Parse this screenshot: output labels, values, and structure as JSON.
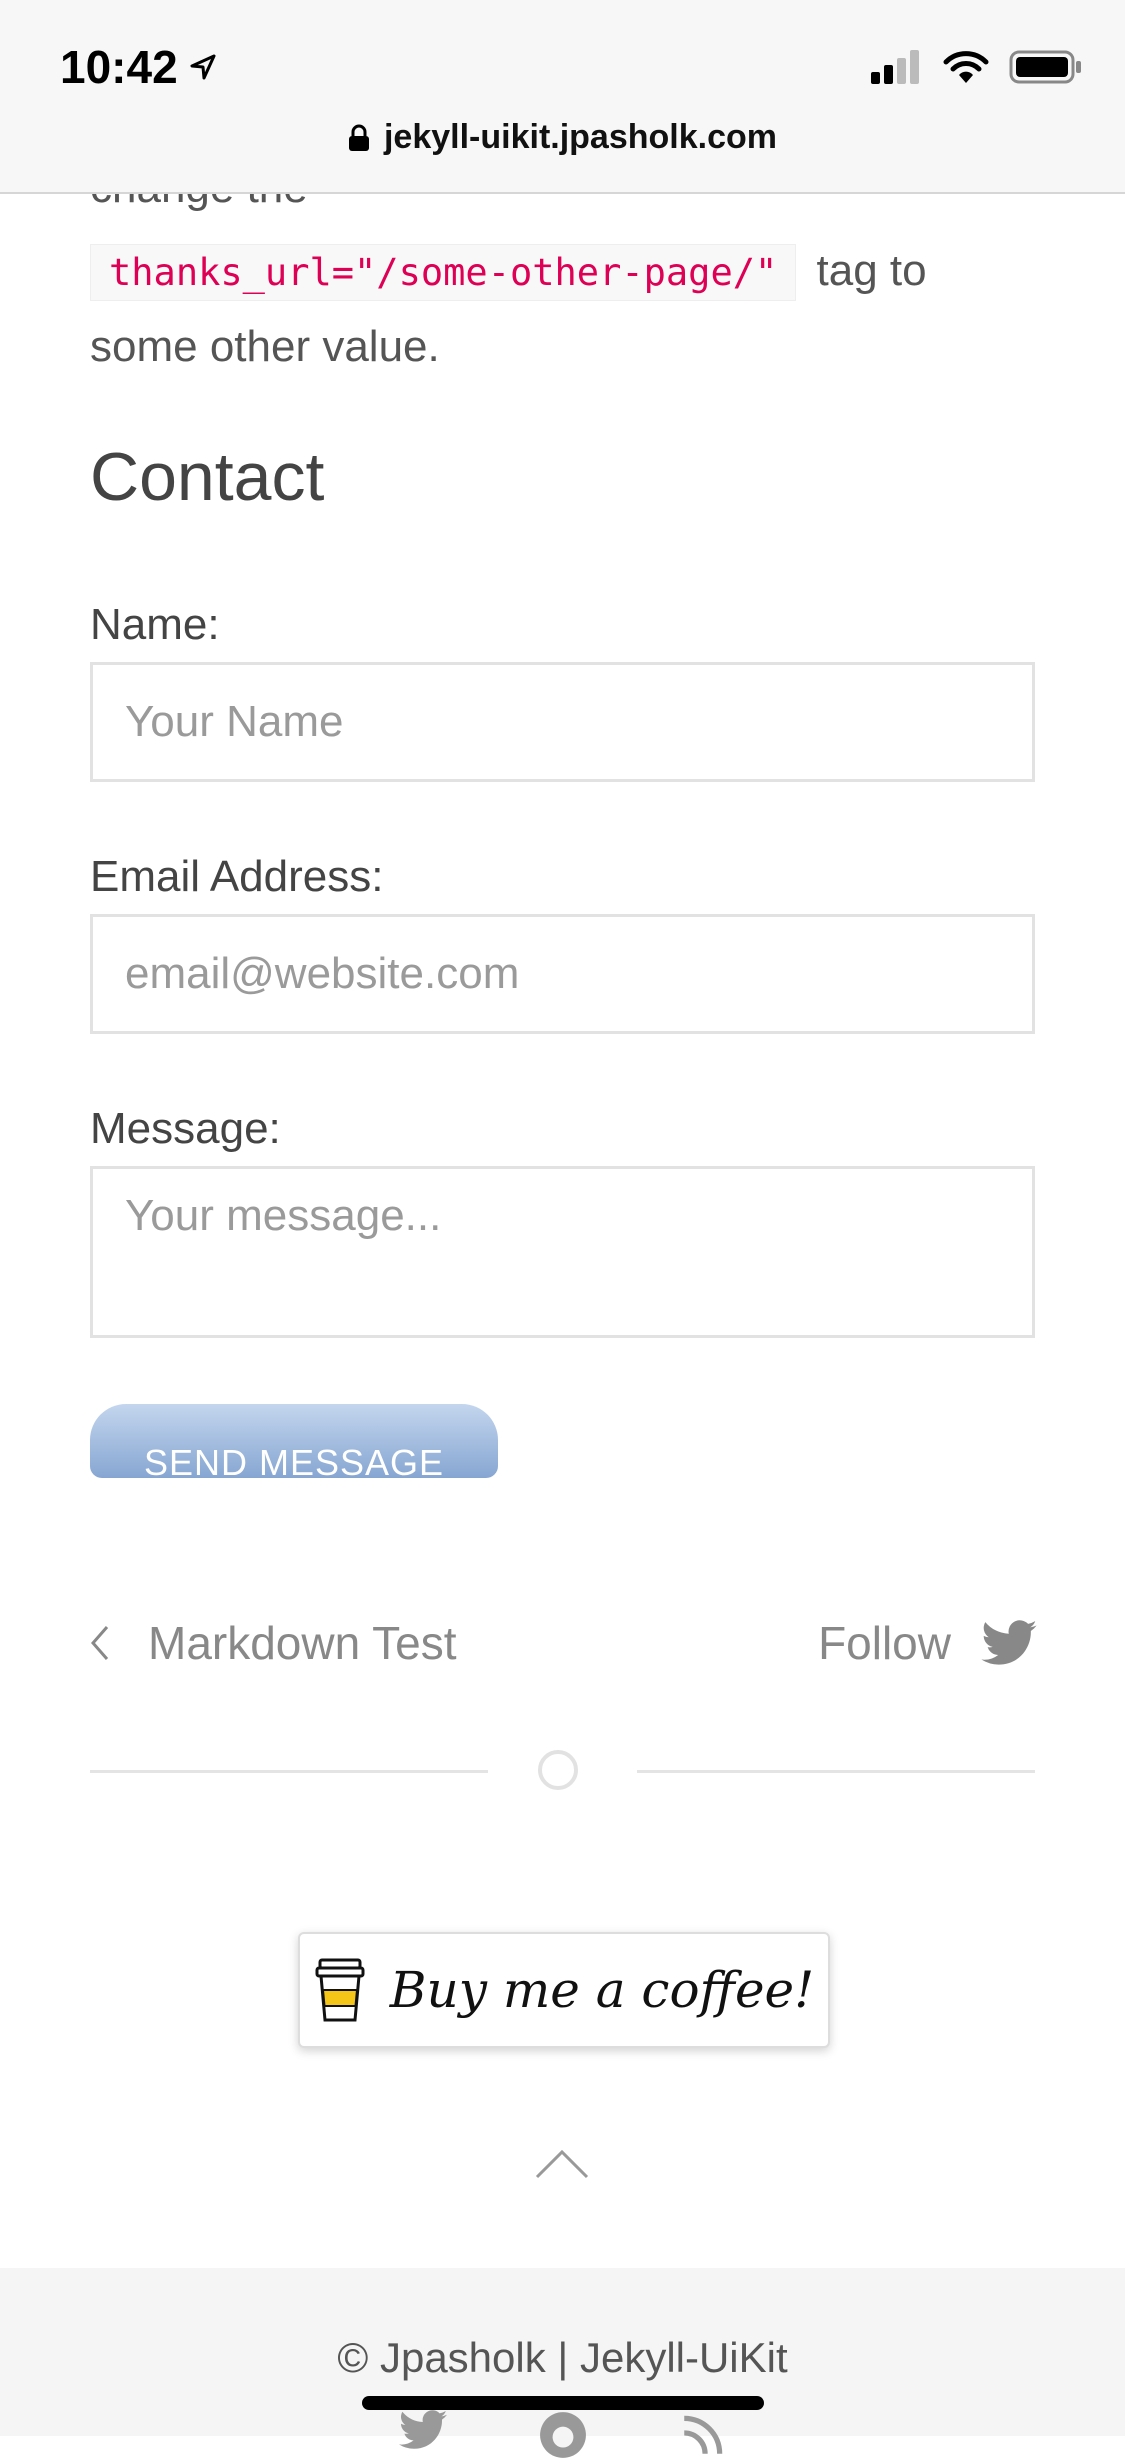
{
  "status_bar": {
    "time": "10:42",
    "url": "jekyll-uikit.jpasholk.com"
  },
  "content": {
    "clipped_text": "change the",
    "code_snippet": "thanks_url=\"/some-other-page/\"",
    "after_code": "tag to",
    "para_line2": "some other value.",
    "heading": "Contact"
  },
  "form": {
    "name_label": "Name:",
    "name_placeholder": "Your Name",
    "email_label": "Email Address:",
    "email_placeholder": "email@website.com",
    "message_label": "Message:",
    "message_placeholder": "Your message...",
    "send_label": "SEND MESSAGE"
  },
  "post_nav": {
    "prev_label": "Markdown Test",
    "follow_label": "Follow"
  },
  "coffee_button": {
    "label": "Buy me a coffee!"
  },
  "footer": {
    "text": "© Jpasholk | Jekyll-UiKit"
  },
  "colors": {
    "accent": "#86a6d2",
    "code": "#dd0055",
    "text": "#555555"
  }
}
